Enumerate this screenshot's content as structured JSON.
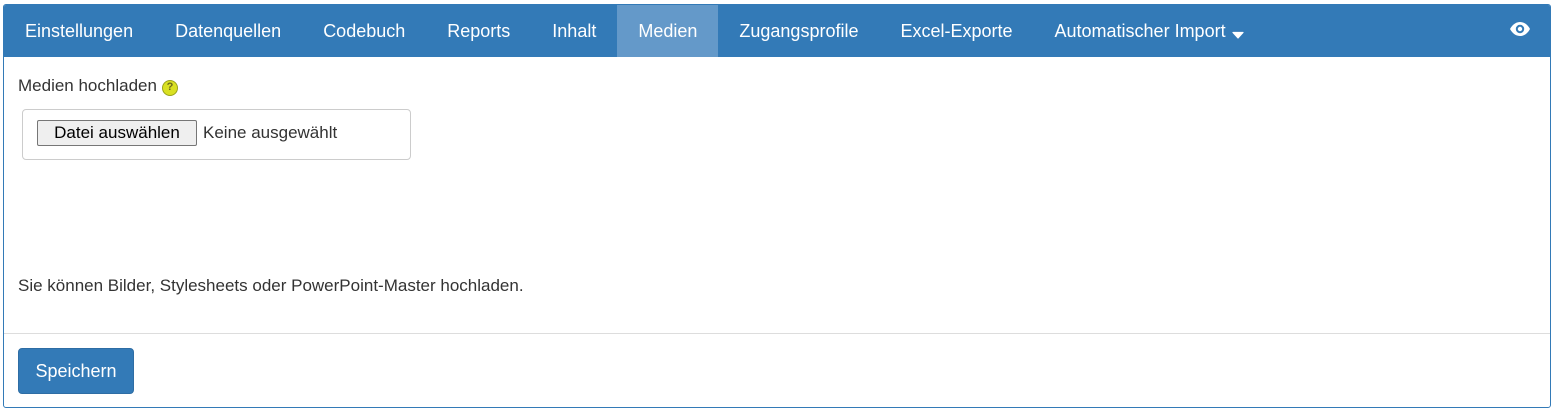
{
  "navbar": {
    "items": [
      {
        "label": "Einstellungen",
        "active": false
      },
      {
        "label": "Datenquellen",
        "active": false
      },
      {
        "label": "Codebuch",
        "active": false
      },
      {
        "label": "Reports",
        "active": false
      },
      {
        "label": "Inhalt",
        "active": false
      },
      {
        "label": "Medien",
        "active": true
      },
      {
        "label": "Zugangsprofile",
        "active": false
      },
      {
        "label": "Excel-Exporte",
        "active": false
      },
      {
        "label": "Automatischer Import",
        "active": false,
        "icon": "caret-down-icon"
      }
    ],
    "right_icon": "eye-icon",
    "colors": {
      "background": "#337ab7",
      "active": "#6499c9",
      "text": "#ffffff"
    }
  },
  "upload": {
    "label": "Medien hochladen",
    "help_icon": "help-icon",
    "help_glyph": "?",
    "button_label": "Datei auswählen",
    "status": "Keine ausgewählt"
  },
  "info": {
    "text": "Sie können Bilder, Stylesheets oder PowerPoint-Master hochladen."
  },
  "footer": {
    "save_label": "Speichern",
    "save_color": "#337ab7"
  }
}
